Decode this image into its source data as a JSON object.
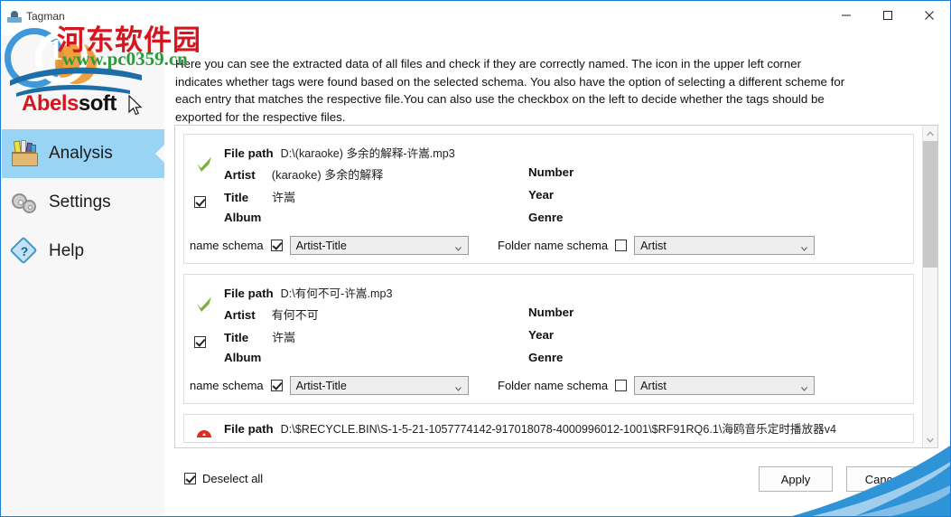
{
  "window": {
    "title": "Tagman",
    "controls": {
      "minimize": "minimize-button",
      "maximize": "maximize-button",
      "close": "close-button"
    }
  },
  "branding": {
    "logo_primary": "Abels",
    "logo_secondary": "soft",
    "watermark_cn": "河东软件园",
    "watermark_url": "www.pc0359.cn",
    "watermark_digit": "1"
  },
  "sidebar": {
    "items": [
      {
        "label": "Analysis",
        "icon": "toolbox-icon",
        "active": true
      },
      {
        "label": "Settings",
        "icon": "gears-icon",
        "active": false
      },
      {
        "label": "Help",
        "icon": "question-diamond-icon",
        "active": false
      }
    ]
  },
  "main": {
    "intro": "Here you can see the extracted data of all files and check if they are correctly named. The icon in the upper left corner indicates whether tags were found based on the selected schema. You also have the option of selecting a different scheme for each entry that matches the respective file.You can also use the checkbox on the left to decide whether the tags should be exported for the respective files.",
    "field_labels": {
      "file_path": "File path",
      "artist": "Artist",
      "title": "Title",
      "album": "Album",
      "number": "Number",
      "year": "Year",
      "genre": "Genre"
    },
    "schema_labels": {
      "name_schema": "name schema",
      "folder_name_schema": "Folder name schema"
    },
    "entries": [
      {
        "status": "ok",
        "selected": true,
        "file_path": "D:\\(karaoke) 多余的解释-许嵩.mp3",
        "artist": "(karaoke) 多余的解释",
        "title": "许嵩",
        "album": "",
        "number": "",
        "year": "",
        "genre": "",
        "name_schema_enabled": true,
        "name_schema_value": "Artist-Title",
        "folder_schema_enabled": false,
        "folder_schema_value": "Artist"
      },
      {
        "status": "ok",
        "selected": true,
        "file_path": "D:\\有何不可-许嵩.mp3",
        "artist": "有何不可",
        "title": "许嵩",
        "album": "",
        "number": "",
        "year": "",
        "genre": "",
        "name_schema_enabled": true,
        "name_schema_value": "Artist-Title",
        "folder_schema_enabled": false,
        "folder_schema_value": "Artist"
      },
      {
        "status": "error",
        "selected": false,
        "file_path": "D:\\$RECYCLE.BIN\\S-1-5-21-1057774142-917018078-4000996012-1001\\$RF91RQ6.1\\海鸥音乐定时播放器v4"
      }
    ]
  },
  "footer": {
    "deselect_all": "Deselect all",
    "deselect_all_checked": true,
    "apply": "Apply",
    "cancel": "Cancel"
  },
  "colors": {
    "accent": "#1a7fd4",
    "sidebar_active": "#9ad4f5",
    "logo_red": "#d7151f",
    "status_ok": "#6aaa30",
    "status_error": "#e02b20",
    "watermark_green": "#2a9a3c"
  }
}
